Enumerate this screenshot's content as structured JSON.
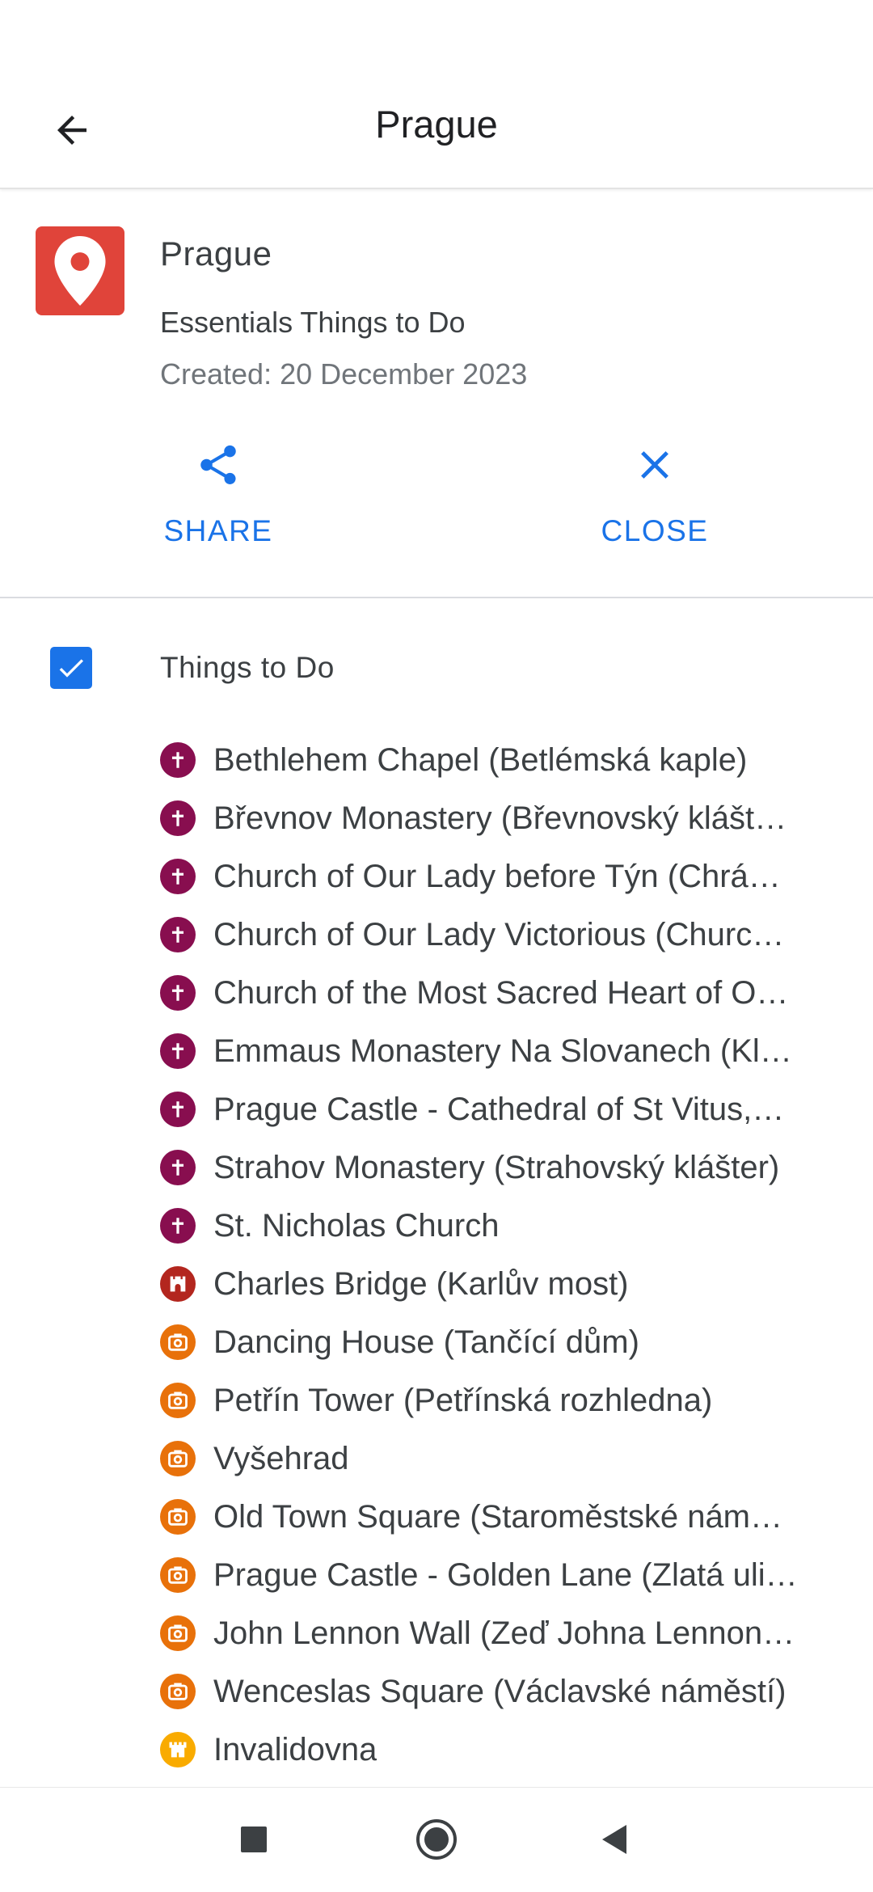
{
  "app_bar": {
    "title": "Prague"
  },
  "map": {
    "name": "Prague",
    "description": "Essentials Things to Do",
    "created": "Created: 20 December 2023"
  },
  "actions": {
    "share_label": "SHARE",
    "close_label": "CLOSE"
  },
  "colors": {
    "accent": "#1a73e8",
    "logo": "#e0443a",
    "church": "#880e4f",
    "landmark": "#b3261e",
    "sight": "#e8710a",
    "castle": "#f9ab00"
  },
  "layer": {
    "title": "Things to Do",
    "checked": true,
    "places": [
      {
        "name": "Bethlehem Chapel (Betlémská kaple)",
        "icon": "church-icon"
      },
      {
        "name": "Břevnov Monastery (Břevnovský klášt…",
        "icon": "church-icon"
      },
      {
        "name": "Church of Our Lady before Týn (Chrá…",
        "icon": "church-icon"
      },
      {
        "name": "Church of Our Lady Victorious (Churc…",
        "icon": "church-icon"
      },
      {
        "name": "Church of the Most Sacred Heart of O…",
        "icon": "church-icon"
      },
      {
        "name": "Emmaus Monastery Na Slovanech (Kl…",
        "icon": "church-icon"
      },
      {
        "name": "Prague Castle - Cathedral of St Vitus,…",
        "icon": "church-icon"
      },
      {
        "name": "Strahov Monastery (Strahovský klášter)",
        "icon": "church-icon"
      },
      {
        "name": "St. Nicholas Church",
        "icon": "church-icon"
      },
      {
        "name": "Charles Bridge (Karlův most)",
        "icon": "bridge-icon"
      },
      {
        "name": "Dancing House (Tančící dům)",
        "icon": "camera-icon"
      },
      {
        "name": "Petřín Tower (Petřínská rozhledna)",
        "icon": "camera-icon"
      },
      {
        "name": "Vyšehrad",
        "icon": "camera-icon"
      },
      {
        "name": "Old Town Square (Staroměstské nám…",
        "icon": "camera-icon"
      },
      {
        "name": "Prague Castle - Golden Lane (Zlatá uli…",
        "icon": "camera-icon"
      },
      {
        "name": "John Lennon Wall (Zeď Johna Lennon…",
        "icon": "camera-icon"
      },
      {
        "name": "Wenceslas Square (Václavské náměstí)",
        "icon": "camera-icon"
      },
      {
        "name": "Invalidovna",
        "icon": "castle-icon"
      }
    ]
  }
}
